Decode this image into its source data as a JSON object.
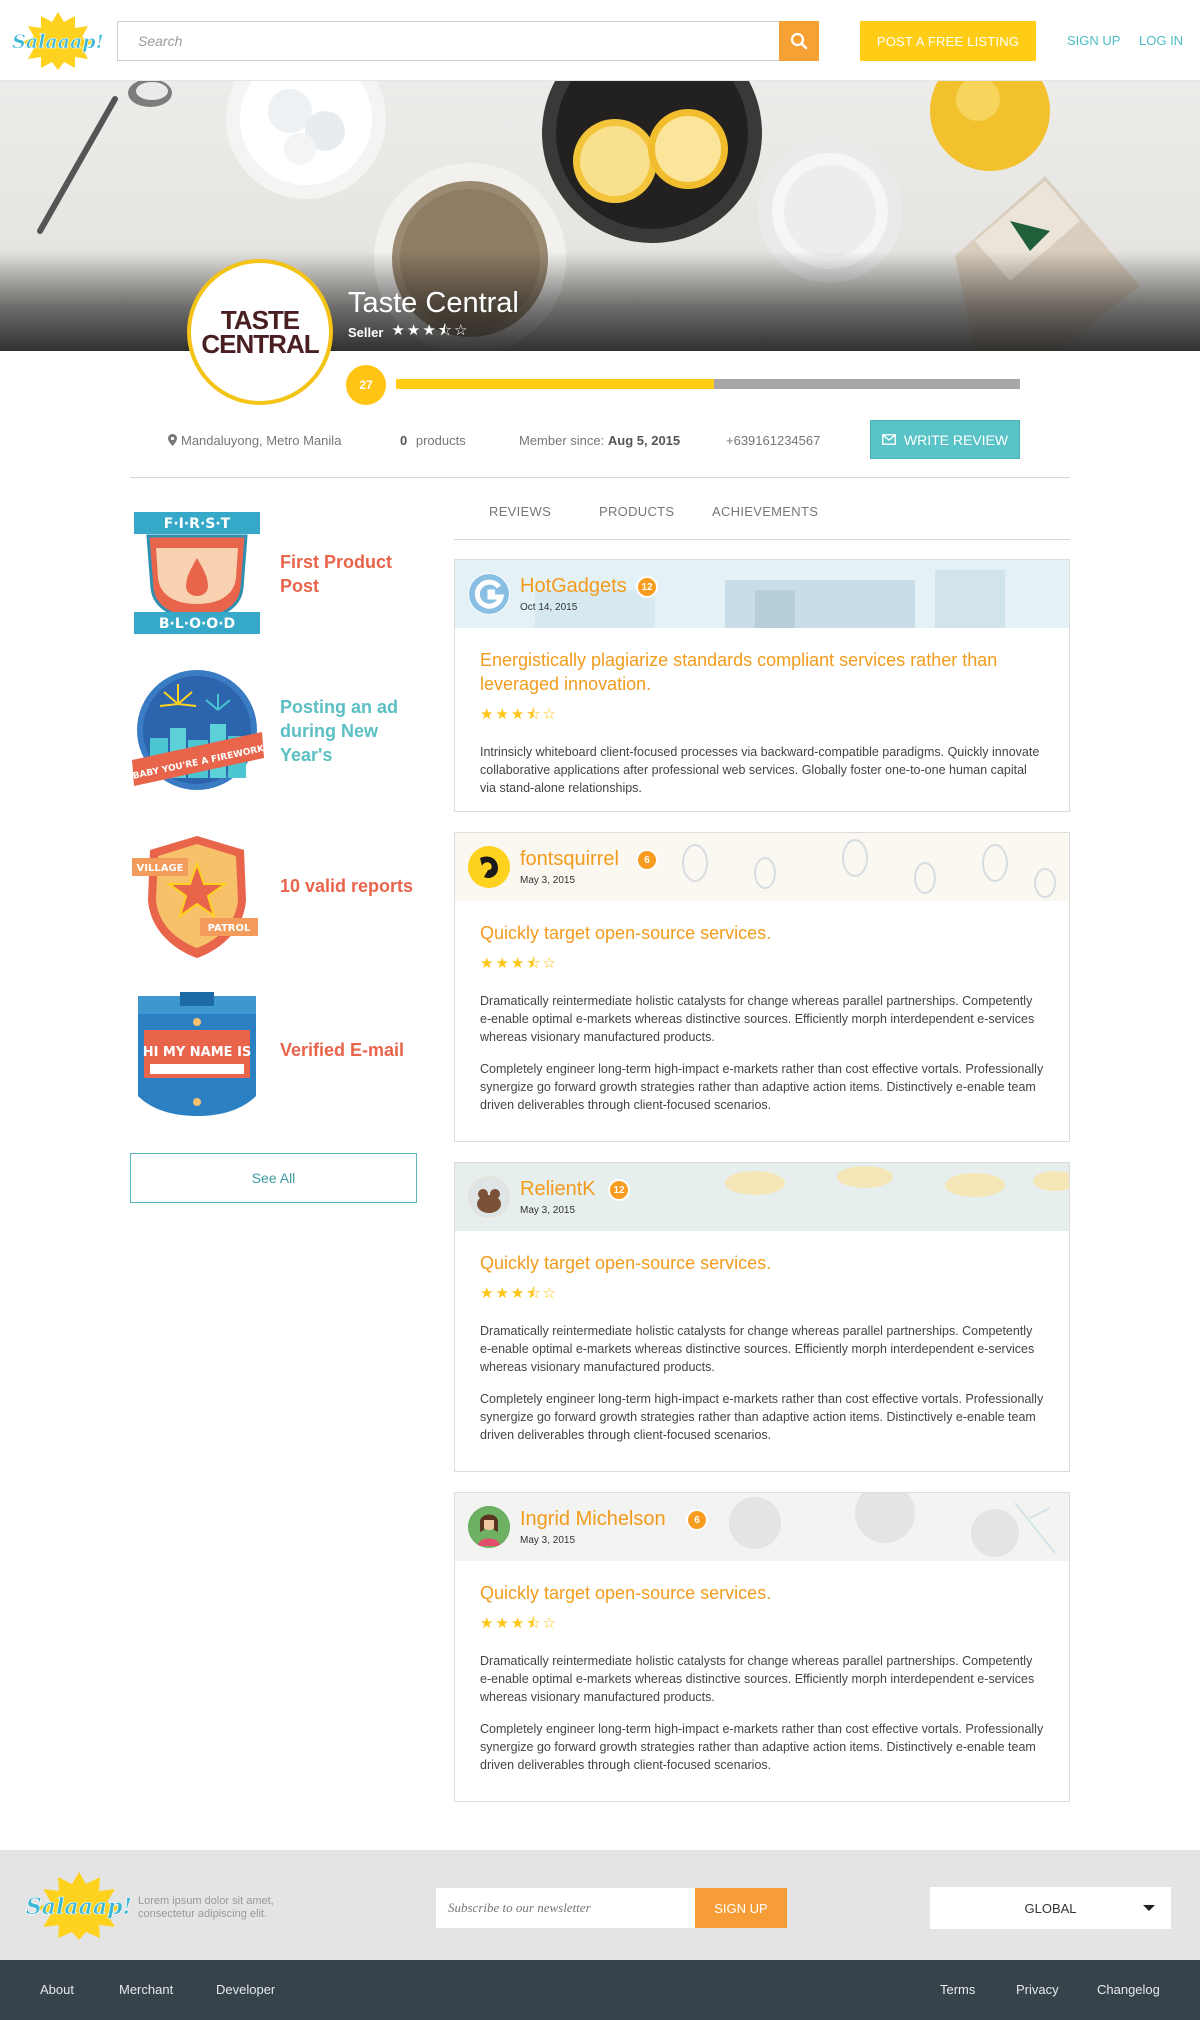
{
  "header": {
    "search_placeholder": "Search",
    "post_listing_label": "POST A FREE LISTING",
    "signup_label": "SIGN UP",
    "login_label": "LOG IN"
  },
  "store": {
    "name": "Taste Central",
    "logo_text_line1": "TASTE",
    "logo_text_line2": "CENTRAL",
    "role": "Seller",
    "rating_stars": 3.5,
    "level": "27",
    "level_progress": 0.51,
    "location": "Mandaluyong, Metro Manila",
    "products_count": "0",
    "products_label": "products",
    "member_since_label": "Member since:",
    "member_since_date": "Aug 5, 2015",
    "phone": "+639161234567",
    "write_review_label": "WRITE REVIEW"
  },
  "achievements": [
    {
      "label": "First Product Post",
      "color": "#e8644b",
      "badge": "first-blood-badge"
    },
    {
      "label": "Posting an ad during New Year's",
      "color": "#5bbfc4",
      "badge": "firework-badge"
    },
    {
      "label": "10 valid reports",
      "color": "#e8644b",
      "badge": "village-patrol-badge"
    },
    {
      "label": "Verified E-mail",
      "color": "#e8644b",
      "badge": "name-tag-badge"
    }
  ],
  "see_all_label": "See All",
  "badge_text": {
    "first_top": "F·I·R·S·T",
    "first_bottom": "B·L·O·O·D",
    "firework": "BABY YOU'RE A FIREWORK",
    "village": "VILLAGE",
    "patrol": "PATROL",
    "name_tag": "HI MY NAME IS"
  },
  "tabs": [
    "REVIEWS",
    "PRODUCTS",
    "ACHIEVEMENTS"
  ],
  "reviews": [
    {
      "user": "HotGadgets",
      "user_level": "12",
      "date": "Oct 14, 2015",
      "title": "Energistically plagiarize standards compliant services rather than leveraged innovation.",
      "stars": 3.5,
      "paragraphs": [
        "Intrinsicly whiteboard client-focused processes via backward-compatible paradigms. Quickly innovate collaborative applications after professional web services. Globally foster one-to-one human capital via stand-alone relationships."
      ]
    },
    {
      "user": "fontsquirrel",
      "user_level": "6",
      "date": "May 3, 2015",
      "title": "Quickly target open-source services.",
      "stars": 3.5,
      "paragraphs": [
        "Dramatically reintermediate holistic catalysts for change whereas parallel partnerships. Competently e-enable optimal e-markets whereas distinctive sources. Efficiently morph interdependent e-services whereas visionary manufactured products.",
        "Completely engineer long-term high-impact e-markets rather than cost effective vortals. Professionally synergize go forward growth strategies rather than adaptive action items. Distinctively e-enable team driven deliverables through client-focused scenarios."
      ]
    },
    {
      "user": "RelientK",
      "user_level": "12",
      "date": "May 3, 2015",
      "title": "Quickly target open-source services.",
      "stars": 3.5,
      "paragraphs": [
        "Dramatically reintermediate holistic catalysts for change whereas parallel partnerships. Competently e-enable optimal e-markets whereas distinctive sources. Efficiently morph interdependent e-services whereas visionary manufactured products.",
        "Completely engineer long-term high-impact e-markets rather than cost effective vortals. Professionally synergize go forward growth strategies rather than adaptive action items. Distinctively e-enable team driven deliverables through client-focused scenarios."
      ]
    },
    {
      "user": "Ingrid Michelson",
      "user_level": "6",
      "date": "May 3, 2015",
      "title": "Quickly target open-source services.",
      "stars": 3.5,
      "paragraphs": [
        "Dramatically reintermediate holistic catalysts for change whereas parallel partnerships. Competently e-enable optimal e-markets whereas distinctive sources. Efficiently morph interdependent e-services whereas visionary manufactured products.",
        "Completely engineer long-term high-impact e-markets rather than cost effective vortals. Professionally synergize go forward growth strategies rather than adaptive action items. Distinctively e-enable team driven deliverables through client-focused scenarios."
      ]
    }
  ],
  "footer": {
    "description_line1": "Lorem ipsum dolor sit amet,",
    "description_line2": "consectetur adipiscing elit.",
    "newsletter_placeholder": "Subscribe to our newsletter",
    "newsletter_button": "SIGN UP",
    "region": "GLOBAL",
    "links_left": [
      "About",
      "Merchant",
      "Developer"
    ],
    "links_right": [
      "Terms",
      "Privacy",
      "Changelog"
    ]
  },
  "logo_text": "Salaaap!",
  "colors": {
    "accent_yellow": "#ffcc16",
    "accent_orange": "#f79d37",
    "teal": "#5ac3c7",
    "review_title": "#f29b1c"
  }
}
